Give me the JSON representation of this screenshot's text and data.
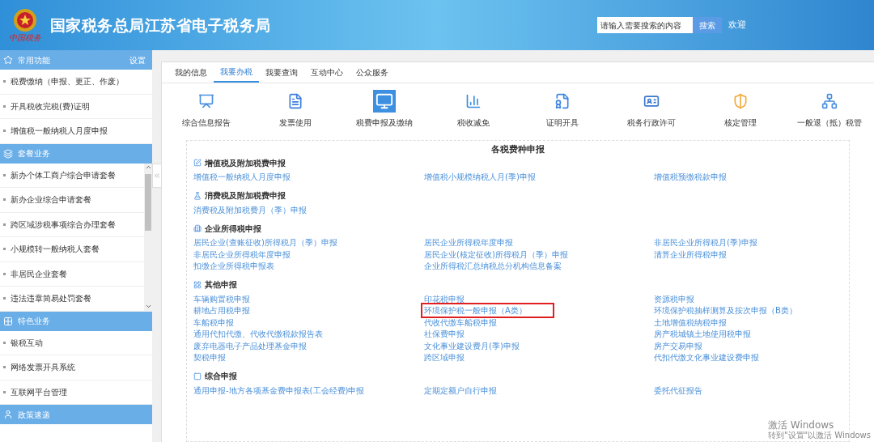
{
  "header": {
    "emblem_caption": "中国税务",
    "title": "国家税务总局江苏省电子税务局",
    "search": {
      "placeholder": "请输入需要搜索的内容",
      "button": "搜索"
    },
    "greeting": "欢迎"
  },
  "sidebar": [
    {
      "title": "常用功能",
      "action": "设置",
      "scrollable": false,
      "items": [
        "税费缴纳（申报、更正、作废）",
        "开具税收完税(费)证明",
        "增值税一般纳税人月度申报"
      ]
    },
    {
      "title": "套餐业务",
      "scrollable": true,
      "items": [
        "新办个体工商户综合申请套餐",
        "新办企业综合申请套餐",
        "跨区域涉税事项综合办理套餐",
        "小规模转一般纳税人套餐",
        "非居民企业套餐",
        "违法违章简易处罚套餐"
      ]
    },
    {
      "title": "特色业务",
      "scrollable": false,
      "items": [
        "银税互动",
        "网络发票开具系统",
        "互联网平台管理"
      ]
    },
    {
      "title": "政策速递"
    }
  ],
  "tabs": [
    {
      "label": "我的信息",
      "selected": false
    },
    {
      "label": "我要办税",
      "selected": true
    },
    {
      "label": "我要查询",
      "selected": false
    },
    {
      "label": "互动中心",
      "selected": false
    },
    {
      "label": "公众服务",
      "selected": false
    }
  ],
  "services": [
    {
      "label": "综合信息报告",
      "selected": false
    },
    {
      "label": "发票使用",
      "selected": false
    },
    {
      "label": "税费申报及缴纳",
      "selected": true
    },
    {
      "label": "税收减免",
      "selected": false
    },
    {
      "label": "证明开具",
      "selected": false
    },
    {
      "label": "税务行政许可",
      "selected": false
    },
    {
      "label": "核定管理",
      "selected": false
    },
    {
      "label": "一般退（抵）税管",
      "selected": false
    }
  ],
  "panel": {
    "title": "各税费种申报",
    "sections": [
      {
        "title": "增值税及附加税费申报",
        "links": [
          {
            "text": "增值税一般纳税人月度申报",
            "highlighted": false
          },
          {
            "text": "增值税小规模纳税人月(季)申报",
            "highlighted": false
          },
          {
            "text": "增值税预缴税款申报",
            "highlighted": false
          }
        ]
      },
      {
        "title": "消费税及附加税费申报",
        "links": [
          {
            "text": "消费税及附加税费月（季）申报",
            "highlighted": false
          }
        ]
      },
      {
        "title": "企业所得税申报",
        "links": [
          {
            "text": "居民企业(查账征收)所得税月（季）申报",
            "highlighted": false
          },
          {
            "text": "居民企业所得税年度申报",
            "highlighted": false
          },
          {
            "text": "非居民企业所得税月(季)申报",
            "highlighted": false
          },
          {
            "text": "非居民企业所得税年度申报",
            "highlighted": false
          },
          {
            "text": "居民企业(核定征收)所得税月（季）申报",
            "highlighted": false
          },
          {
            "text": "清算企业所得税申报",
            "highlighted": false
          },
          {
            "text": "扣缴企业所得税申报表",
            "highlighted": false
          },
          {
            "text": "企业所得税汇总纳税总分机构信息备案",
            "highlighted": false
          }
        ]
      },
      {
        "title": "其他申报",
        "links": [
          {
            "text": "车辆购置税申报",
            "highlighted": false
          },
          {
            "text": "印花税申报",
            "highlighted": false
          },
          {
            "text": "资源税申报",
            "highlighted": false
          },
          {
            "text": "耕地占用税申报",
            "highlighted": false
          },
          {
            "text": "环境保护税一般申报（A类）",
            "highlighted": true
          },
          {
            "text": "环境保护税抽样测算及按次申报（B类）",
            "highlighted": false
          },
          {
            "text": "车船税申报",
            "highlighted": false
          },
          {
            "text": "代收代缴车船税申报",
            "highlighted": false
          },
          {
            "text": "土地增值税纳税申报",
            "highlighted": false
          },
          {
            "text": "通用代扣代缴、代收代缴税款报告表",
            "highlighted": false
          },
          {
            "text": "社保费申报",
            "highlighted": false
          },
          {
            "text": "房产税城镇土地使用税申报",
            "highlighted": false
          },
          {
            "text": "废弃电器电子产品处理基金申报",
            "highlighted": false
          },
          {
            "text": "文化事业建设费月(季)申报",
            "highlighted": false
          },
          {
            "text": "房产交易申报",
            "highlighted": false
          },
          {
            "text": "契税申报",
            "highlighted": false
          },
          {
            "text": "跨区域申报",
            "highlighted": false
          },
          {
            "text": "代扣代缴文化事业建设费申报",
            "highlighted": false
          }
        ]
      },
      {
        "title": "综合申报",
        "links": [
          {
            "text": "通用申报-地方各项基金费申报表(工会经费)申报",
            "highlighted": false
          },
          {
            "text": "定期定额户自行申报",
            "highlighted": false
          },
          {
            "text": "委托代征报告",
            "highlighted": false
          }
        ]
      }
    ]
  },
  "os_notice": {
    "title": "激活 Windows",
    "hint": "转到\"设置\"以激活 Windows"
  }
}
